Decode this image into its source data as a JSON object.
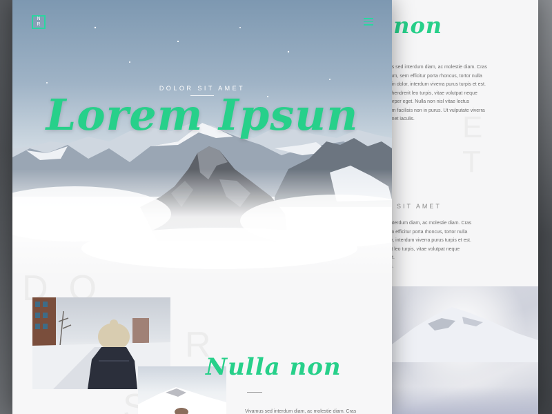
{
  "hero": {
    "kicker": "DOLOR SIT AMET",
    "title": "Lorem Ipsun",
    "logo_letters": [
      "N",
      "Y",
      "R"
    ]
  },
  "section": {
    "title": "Nulla non",
    "first_paragraph_line": "Vivamus sed interdum diam, ac molestie diam. Cras"
  },
  "back_page": {
    "title": "lla non",
    "subtitle": "OR SIT AMET",
    "ghost_letters": "E T",
    "paragraph_1": [
      "mus sed interdum diam, ac molestie diam. Cras",
      "ndum, sem efficitur porta rhoncus, tortor nulla",
      "tudin dolor, interdum viverra purus turpis et est.",
      "us hendrerit leo turpis, vitae volutpat neque",
      "ncorper eget. Nulla non nisl vitae lectus",
      "ntum facilisis non in purus. Ut vulputate viverra",
      "t amet iaculis."
    ],
    "paragraph_2": [
      "d interdum diam, ac molestie diam. Cras",
      "sem efficitur porta rhoncus, tortor nulla",
      "olor, interdum viverra purus turpis et est.",
      "lerit leo turpis, vitae volutpat neque",
      "gert.",
      "ulis."
    ]
  },
  "ghost": {
    "front_1": "DO",
    "front_2": "R",
    "front_3": "S"
  },
  "colors": {
    "accent": "#27d08a",
    "text_muted": "#6d6d6d"
  },
  "icons": [
    "nyr-logo-icon",
    "hamburger-menu-icon"
  ]
}
